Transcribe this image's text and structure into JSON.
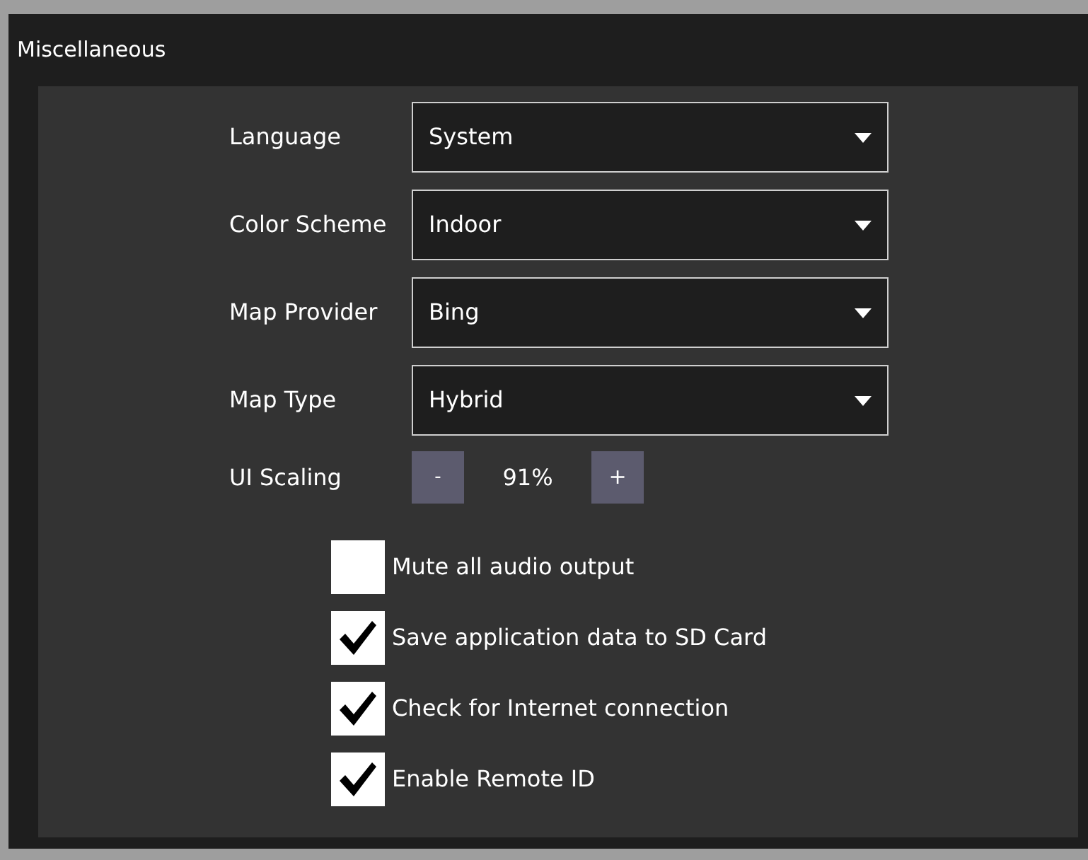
{
  "section": {
    "title": "Miscellaneous"
  },
  "dropdowns": [
    {
      "label": "Language",
      "value": "System"
    },
    {
      "label": "Color Scheme",
      "value": "Indoor"
    },
    {
      "label": "Map Provider",
      "value": "Bing"
    },
    {
      "label": "Map Type",
      "value": "Hybrid"
    }
  ],
  "scaling": {
    "label": "UI Scaling",
    "decrease": "-",
    "value": "91%",
    "increase": "+"
  },
  "checkboxes": [
    {
      "label": "Mute all audio output",
      "checked": false
    },
    {
      "label": "Save application data to SD Card",
      "checked": true
    },
    {
      "label": "Check for Internet connection",
      "checked": true
    },
    {
      "label": "Enable Remote ID",
      "checked": true
    }
  ]
}
